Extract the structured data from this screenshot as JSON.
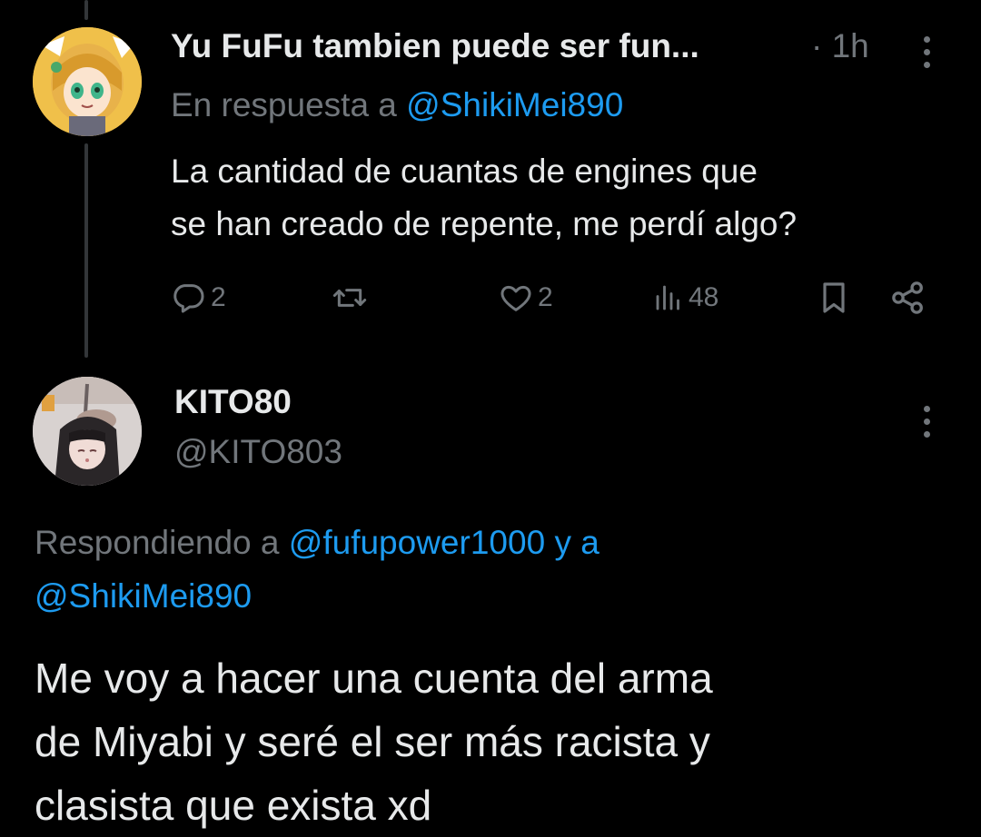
{
  "colors": {
    "background": "#000000",
    "text": "#e7e9ea",
    "muted": "#71767b",
    "link": "#1d9bf0"
  },
  "tweet1": {
    "author_name": "Yu FuFu tambien puede ser fun...",
    "time": "· 1h",
    "reply_prefix": "En respuesta a",
    "reply_handle": "@ShikiMei890",
    "text_lines": [
      "La cantidad de cuantas de engines que",
      "se han creado de repente, me perdí algo?"
    ],
    "actions": {
      "reply_icon": "reply-bubble-icon",
      "reply_count": "2",
      "retweet_icon": "retweet-icon",
      "like_icon": "heart-icon",
      "like_count": "2",
      "views_icon": "views-bar-chart-icon",
      "view_count": "48",
      "bookmark_icon": "bookmark-icon",
      "share_icon": "share-icon"
    },
    "more_icon": "more-vertical-icon"
  },
  "tweet2": {
    "author_name": "KITO80",
    "handle": "@KITO803",
    "more_icon": "more-vertical-icon",
    "reply_prefix": "Respondiendo a",
    "reply_handle_1": "@fufupower1000",
    "reply_joiner": "y a",
    "reply_handle_2": "@ShikiMei890",
    "text_lines": [
      "Me voy a hacer una cuenta del arma",
      "de Miyabi y seré el ser más racista y",
      "clasista que exista xd"
    ]
  }
}
